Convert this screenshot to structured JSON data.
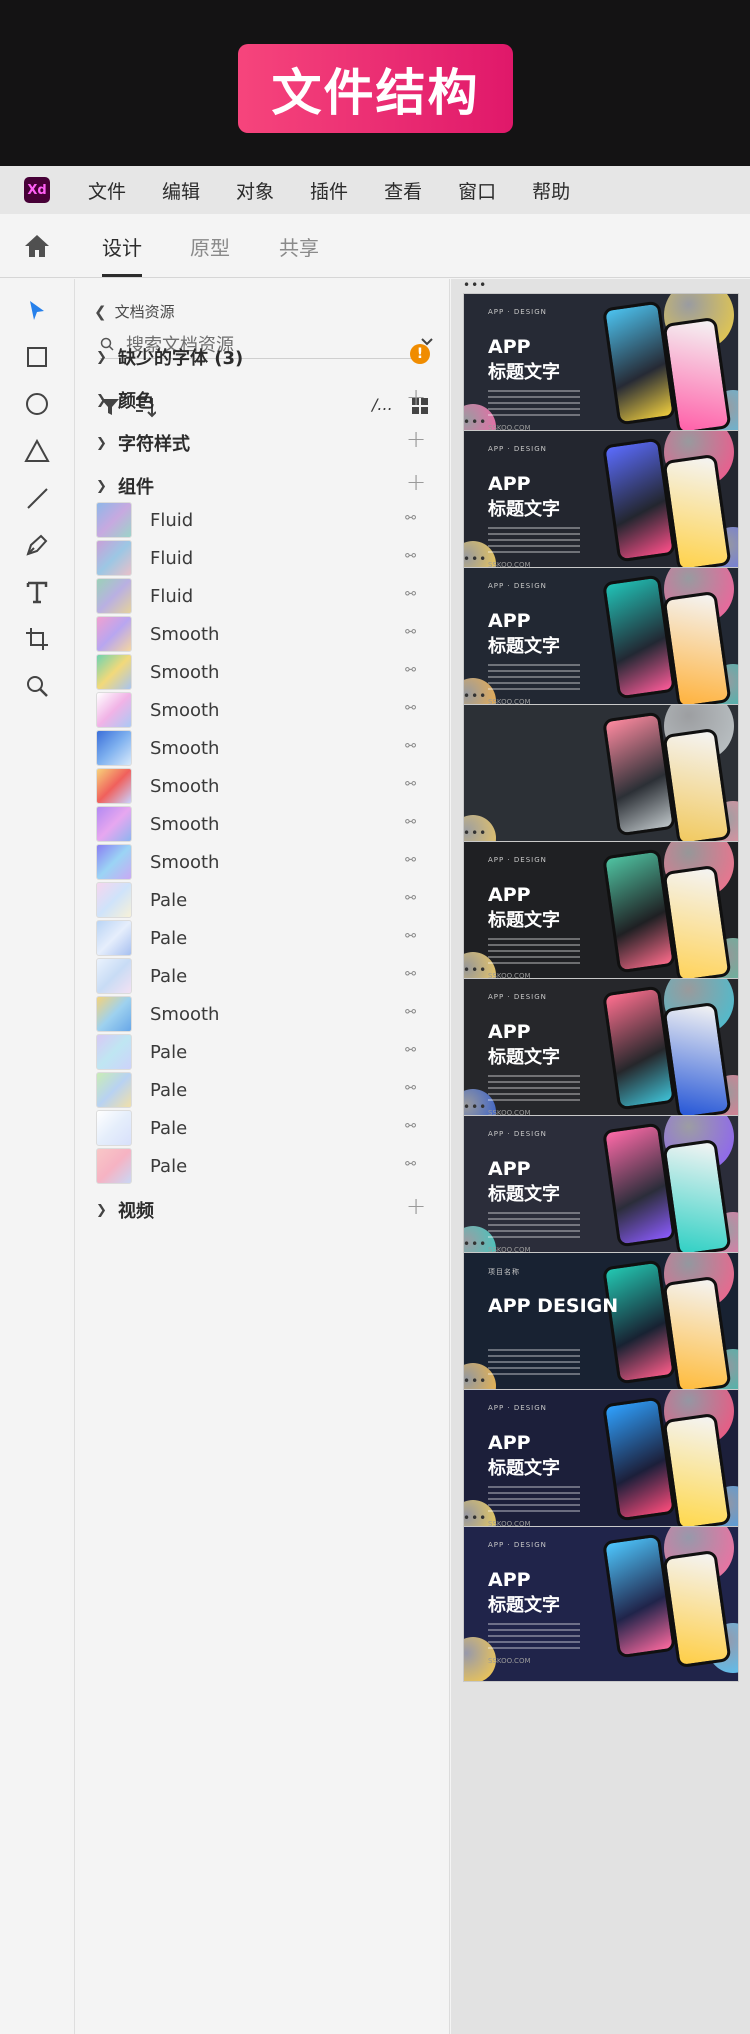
{
  "banner": {
    "title": "文件结构"
  },
  "menubar": {
    "logo": "Xd",
    "items": [
      "文件",
      "编辑",
      "对象",
      "插件",
      "查看",
      "窗口",
      "帮助"
    ]
  },
  "tabs": {
    "items": [
      "设计",
      "原型",
      "共享"
    ],
    "active": "设计"
  },
  "panel": {
    "back_label": "文档资源",
    "search_placeholder": "搜索文档资源",
    "sections": {
      "missing_fonts": "缺少的字体 (3)",
      "colors": "颜色",
      "char_styles": "字符样式",
      "components": "组件",
      "video": "视频"
    },
    "warning_glyph": "!",
    "components": [
      {
        "label": "Fluid"
      },
      {
        "label": "Fluid"
      },
      {
        "label": "Fluid"
      },
      {
        "label": "Smooth"
      },
      {
        "label": "Smooth"
      },
      {
        "label": "Smooth"
      },
      {
        "label": "Smooth"
      },
      {
        "label": "Smooth"
      },
      {
        "label": "Smooth"
      },
      {
        "label": "Smooth"
      },
      {
        "label": "Pale"
      },
      {
        "label": "Pale"
      },
      {
        "label": "Pale"
      },
      {
        "label": "Smooth"
      },
      {
        "label": "Pale"
      },
      {
        "label": "Pale"
      },
      {
        "label": "Pale"
      },
      {
        "label": "Pale"
      }
    ]
  },
  "artboards": [
    {
      "cap": "APP · DESIGN",
      "t1": "APP",
      "t2": "标题文字",
      "url": "SSKOO.COM"
    },
    {
      "cap": "APP · DESIGN",
      "t1": "APP",
      "t2": "标题文字",
      "url": "SSKOO.COM"
    },
    {
      "cap": "APP · DESIGN",
      "t1": "APP",
      "t2": "标题文字",
      "url": "SSKOO.COM"
    },
    {
      "cap": "",
      "t1": "",
      "t2": "",
      "url": ""
    },
    {
      "cap": "APP · DESIGN",
      "t1": "APP",
      "t2": "标题文字",
      "url": "SSKOO.COM"
    },
    {
      "cap": "APP · DESIGN",
      "t1": "APP",
      "t2": "标题文字",
      "url": "SSKOO.COM"
    },
    {
      "cap": "APP · DESIGN",
      "t1": "APP",
      "t2": "标题文字",
      "url": "SSKOO.COM"
    },
    {
      "cap": "项目名称",
      "t1": "APP DESIGN",
      "t2": "",
      "url": ""
    },
    {
      "cap": "APP · DESIGN",
      "t1": "APP",
      "t2": "标题文字",
      "url": "SSKOO.COM"
    },
    {
      "cap": "APP · DESIGN",
      "t1": "APP",
      "t2": "标题文字",
      "url": "SSKOO.COM"
    }
  ],
  "colors": {
    "accent": "#2680eb",
    "banner_pink": "#f6457c",
    "xd_purple": "#470137"
  }
}
